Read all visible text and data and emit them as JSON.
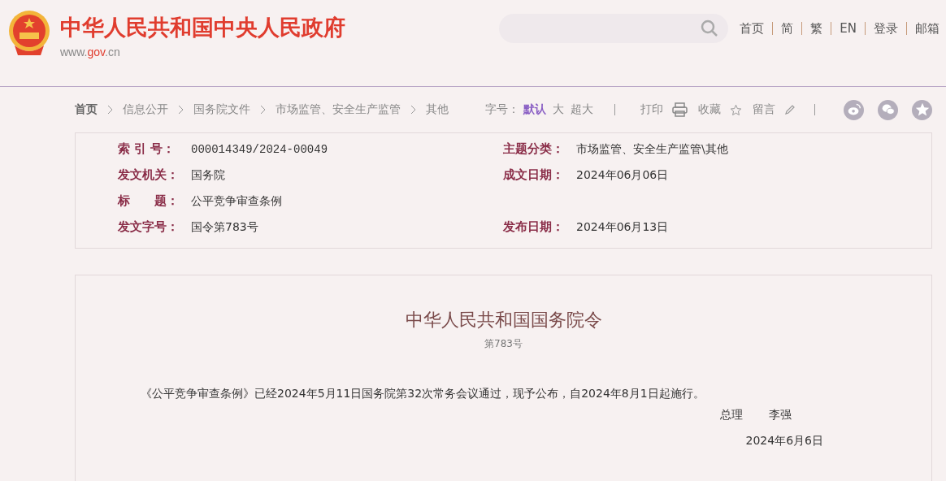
{
  "header": {
    "site_title": "中华人民共和国中央人民政府",
    "site_url_parts": [
      {
        "text": "www.",
        "accent": false
      },
      {
        "text": "gov",
        "accent": true
      },
      {
        "text": ".cn",
        "accent": false
      }
    ],
    "nav_links": [
      "首页",
      "简",
      "繁",
      "EN",
      "登录",
      "邮箱"
    ]
  },
  "breadcrumb": [
    "首页",
    "信息公开",
    "国务院文件",
    "市场监管、安全生产监管",
    "其他"
  ],
  "tools": {
    "font_size_label": "字号：",
    "font_sizes": [
      {
        "label": "默认",
        "selected": true
      },
      {
        "label": "大",
        "selected": false
      },
      {
        "label": "超大",
        "selected": false
      }
    ],
    "actions": [
      {
        "label": "打印",
        "kind": "print"
      },
      {
        "label": "收藏",
        "kind": "star"
      },
      {
        "label": "留言",
        "kind": "pencil"
      }
    ],
    "share": [
      {
        "kind": "weibo"
      },
      {
        "kind": "wechat"
      },
      {
        "kind": "qzone"
      }
    ]
  },
  "meta": [
    {
      "cells": [
        {
          "label": "索 引 号：",
          "value": "000014349/2024-00049"
        },
        {
          "label": "主题分类：",
          "value": "市场监管、安全生产监管\\其他"
        }
      ]
    },
    {
      "cells": [
        {
          "label": "发文机关：",
          "value": "国务院"
        },
        {
          "label": "成文日期：",
          "value": "2024年06月06日"
        }
      ]
    },
    {
      "cells": [
        {
          "label": "标　　题：",
          "value": "公平竞争审查条例"
        }
      ]
    },
    {
      "cells": [
        {
          "label": "发文字号：",
          "value": "国令第783号"
        },
        {
          "label": "发布日期：",
          "value": "2024年06月13日"
        }
      ]
    }
  ],
  "document": {
    "title": "中华人民共和国国务院令",
    "number": "第783号",
    "body": "《公平竞争审查条例》已经2024年5月11日国务院第32次常务会议通过，现予公布，自2024年8月1日起施行。",
    "signer_title": "总理",
    "signer_name": "李强",
    "date": "2024年6月6日"
  }
}
